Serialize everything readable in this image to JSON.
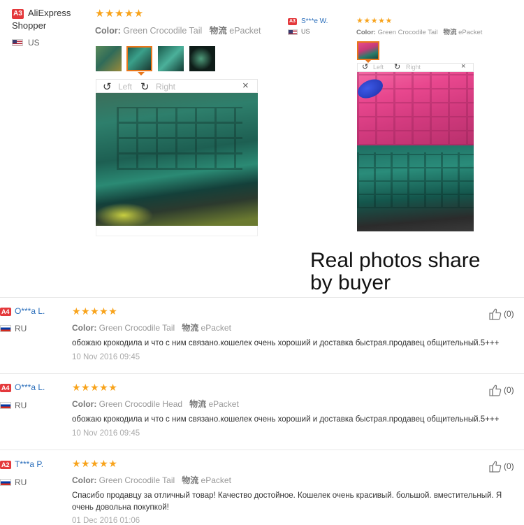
{
  "reviews_top": [
    {
      "badge": "A3",
      "name_line1": "AliExpress",
      "name_line2": "Shopper",
      "country": "US",
      "stars": "★★★★★",
      "color_label": "Color:",
      "color_value": "Green Crocodile Tail",
      "shipping_label": "物流",
      "shipping_value": "ePacket",
      "viewer": {
        "left": "Left",
        "right": "Right",
        "close": "×"
      }
    },
    {
      "badge": "A3",
      "name": "S***e W.",
      "country": "US",
      "stars": "★★★★★",
      "color_label": "Color:",
      "color_value": "Green Crocodile Tail",
      "shipping_label": "物流",
      "shipping_value": "ePacket",
      "viewer": {
        "left": "Left",
        "right": "Right",
        "close": "×"
      }
    }
  ],
  "overlay_caption": {
    "line1": "Real photos share",
    "line2": "by buyer"
  },
  "reviews": [
    {
      "badge": "A4",
      "name": "O***a L.",
      "country": "RU",
      "stars": "★★★★★",
      "color_label": "Color:",
      "color_value": "Green Crocodile Tail",
      "shipping_label": "物流",
      "shipping_value": "ePacket",
      "text": "обожаю крокодила и что с ним связано.кошелек очень хороший и доставка быстрая.продавец общительный.5+++",
      "date": "10 Nov 2016 09:45",
      "helpful": "(0)"
    },
    {
      "badge": "A4",
      "name": "O***a L.",
      "country": "RU",
      "stars": "★★★★★",
      "color_label": "Color:",
      "color_value": "Green Crocodile Head",
      "shipping_label": "物流",
      "shipping_value": "ePacket",
      "text": "обожаю крокодила и что с ним связано.кошелек очень хороший и доставка быстрая.продавец общительный.5+++",
      "date": "10 Nov 2016 09:45",
      "helpful": "(0)"
    },
    {
      "badge": "A2",
      "name": "T***a P.",
      "country": "RU",
      "stars": "★★★★★",
      "color_label": "Color:",
      "color_value": "Green Crocodile Tail",
      "shipping_label": "物流",
      "shipping_value": "ePacket",
      "text_line1": "Спасибо продавцу за отличный товар! Качество достойное. Кошелек очень красивый. большой. вместительный. Я",
      "text_line2": "очень довольна покупкой!",
      "date": "01 Dec 2016 01:06",
      "helpful": "(0)"
    }
  ],
  "colors": {
    "accent": "#e4393c",
    "star": "#f8a31b",
    "name_link": "#2a6ebb",
    "thumb_select": "#e8771b"
  },
  "icons": [
    "rotate-left-icon",
    "rotate-right-icon",
    "close-icon",
    "thumbs-up-icon",
    "us-flag-icon",
    "ru-flag-icon"
  ]
}
